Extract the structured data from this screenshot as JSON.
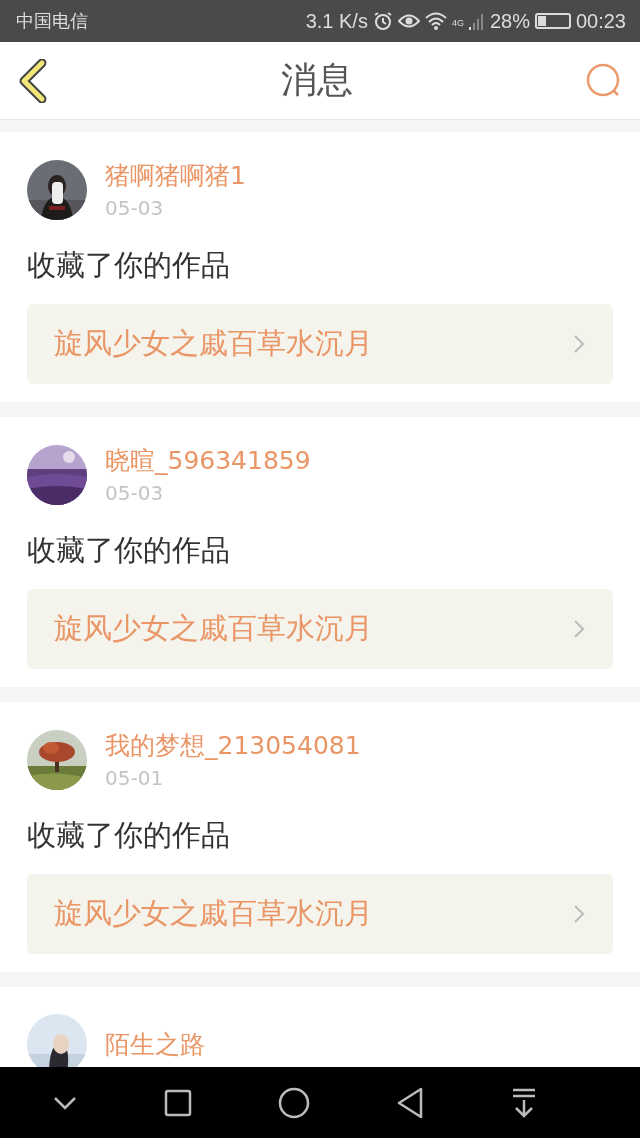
{
  "status_bar": {
    "carrier": "中国电信",
    "speed": "3.1 K/s",
    "network": "4G",
    "battery": "28%",
    "time": "00:23"
  },
  "header": {
    "title": "消息"
  },
  "messages": [
    {
      "user": "猪啊猪啊猪1",
      "date": "05-03",
      "action": "收藏了你的作品",
      "work": "旋风少女之戚百草水沉月"
    },
    {
      "user": "晓暄_596341859",
      "date": "05-03",
      "action": "收藏了你的作品",
      "work": "旋风少女之戚百草水沉月"
    },
    {
      "user": "我的梦想_213054081",
      "date": "05-01",
      "action": "收藏了你的作品",
      "work": "旋风少女之戚百草水沉月"
    },
    {
      "user": "陌生之路"
    }
  ]
}
